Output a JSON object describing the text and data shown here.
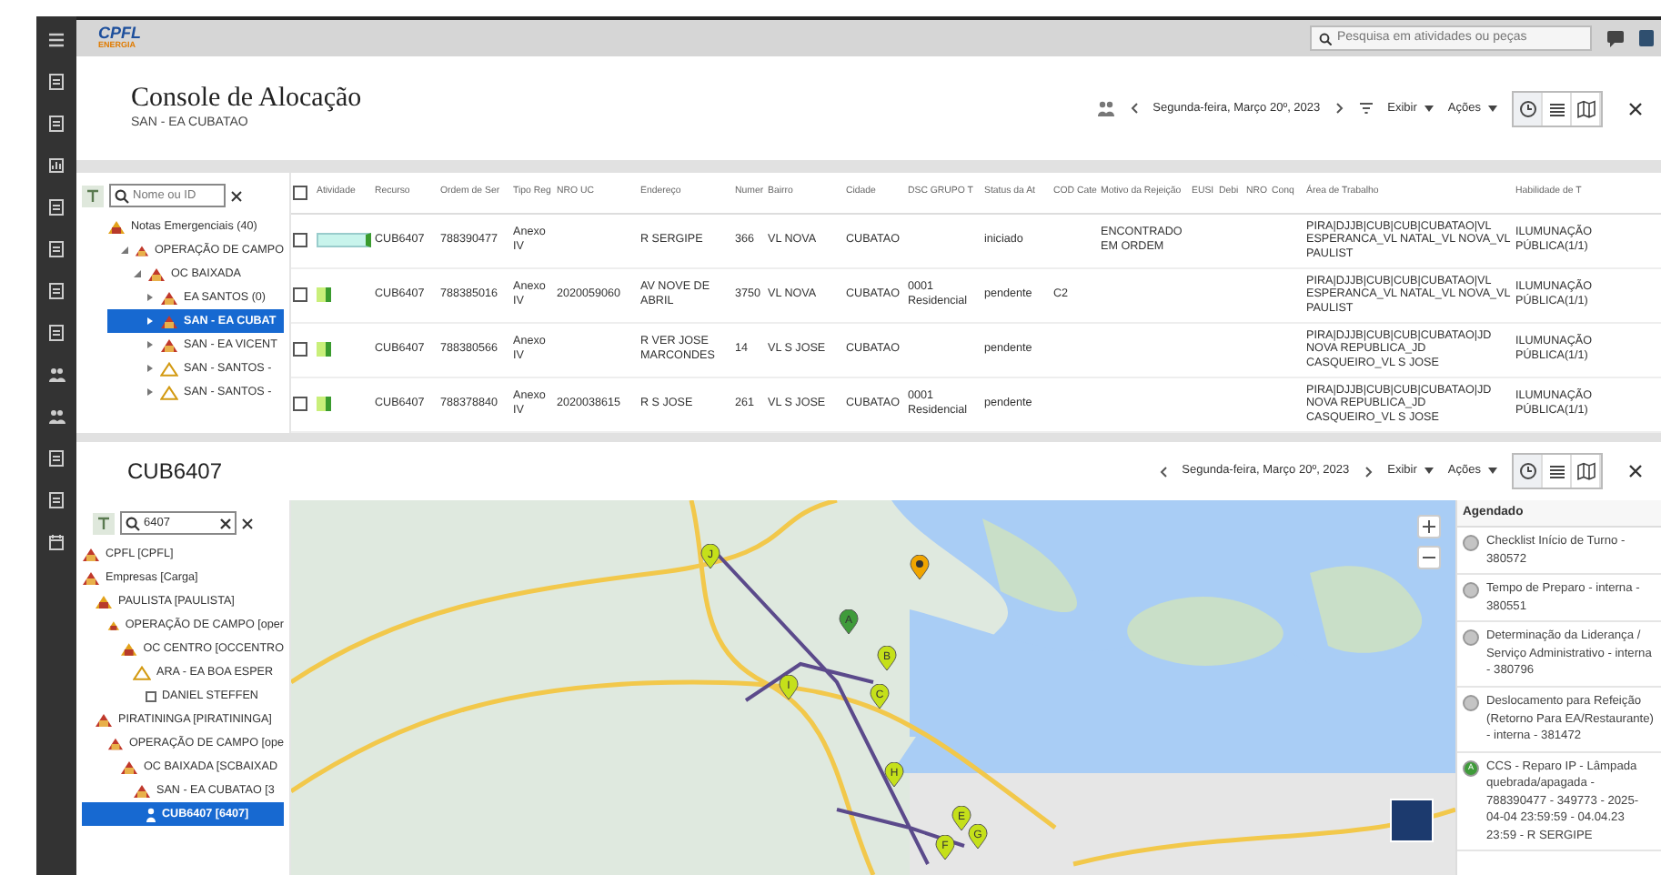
{
  "top_bar": {
    "logo": "CPFL",
    "logo_sub": "ENERGIA",
    "search": {
      "placeholder": "Pesquisa em atividades ou peças"
    }
  },
  "header": {
    "title": "Console de Alocação",
    "subtitle": "SAN - EA CUBATAO",
    "date": "Segunda-feira, Março 20º, 2023",
    "view_menu": "Exibir",
    "actions_menu": "Ações"
  },
  "upper_tree": {
    "search": {
      "placeholder": "Nome ou ID"
    },
    "items": [
      {
        "label": "Notas Emergenciais (40)",
        "kind": "yellow",
        "selected": false,
        "children": [
          {
            "label": "OPERAÇÃO DE CAMPO",
            "kind": "red",
            "expanded": true,
            "selected": false,
            "children": [
              {
                "label": "OC BAIXADA",
                "kind": "red",
                "expanded": true,
                "selected": false,
                "children": [
                  {
                    "label": "EA SANTOS (0)",
                    "kind": "red",
                    "expanded": false,
                    "selected": false
                  },
                  {
                    "label": "SAN - EA CUBAT",
                    "kind": "red",
                    "expanded": false,
                    "selected": true
                  },
                  {
                    "label": "SAN - EA VICENT",
                    "kind": "red",
                    "expanded": false,
                    "selected": false
                  },
                  {
                    "label": "SAN - SANTOS -",
                    "kind": "outline",
                    "expanded": false,
                    "selected": false
                  },
                  {
                    "label": "SAN - SANTOS -",
                    "kind": "outline",
                    "expanded": false,
                    "selected": false
                  }
                ]
              }
            ]
          }
        ]
      }
    ]
  },
  "table": {
    "header_checked": false,
    "activity_column": "Atividade",
    "columns": [
      "Recurso",
      "Ordem de Ser",
      "Tipo Reg",
      "NRO UC",
      "Endereço",
      "Numer",
      "Bairro",
      "Cidade",
      "DSC GRUPO T",
      "Status da At",
      "COD Cate",
      "Motivo da Rejeição",
      "EUSI",
      "Debi",
      "NRO",
      "Conq",
      "Área de Trabalho",
      "Habilidade de T"
    ],
    "rows": [
      {
        "checked": false,
        "kind": "wide",
        "cells": [
          "CUB6407",
          "788390477",
          "Anexo IV",
          null,
          "R SERGIPE",
          "366",
          "VL NOVA",
          "CUBATAO",
          null,
          "iniciado",
          null,
          "ENCONTRADO EM ORDEM",
          null,
          null,
          null,
          null,
          "PIRA|DJJB|CUB|CUB|CUBATAO|VL ESPERANCA_VL NATAL_VL NOVA_VL PAULIST",
          "ILUMUNAÇÃO PÚBLICA(1/1)"
        ]
      },
      {
        "checked": false,
        "kind": "short",
        "cells": [
          "CUB6407",
          "788385016",
          "Anexo IV",
          "2020059060",
          "AV NOVE DE ABRIL",
          "3750",
          "VL NOVA",
          "CUBATAO",
          "0001 Residencial",
          "pendente",
          "C2",
          null,
          null,
          null,
          null,
          null,
          "PIRA|DJJB|CUB|CUB|CUBATAO|VL ESPERANCA_VL NATAL_VL NOVA_VL PAULIST",
          "ILUMUNAÇÃO PÚBLICA(1/1)"
        ]
      },
      {
        "checked": false,
        "kind": "short",
        "cells": [
          "CUB6407",
          "788380566",
          "Anexo IV",
          null,
          "R VER JOSE MARCONDES",
          "14",
          "VL S JOSE",
          "CUBATAO",
          null,
          "pendente",
          null,
          null,
          null,
          null,
          null,
          null,
          "PIRA|DJJB|CUB|CUB|CUBATAO|JD NOVA REPUBLICA_JD CASQUEIRO_VL S JOSE",
          "ILUMUNAÇÃO PÚBLICA(1/1)"
        ]
      },
      {
        "checked": false,
        "kind": "short",
        "cells": [
          "CUB6407",
          "788378840",
          "Anexo IV",
          "2020038615",
          "R S JOSE",
          "261",
          "VL S JOSE",
          "CUBATAO",
          "0001 Residencial",
          "pendente",
          null,
          null,
          null,
          null,
          null,
          null,
          "PIRA|DJJB|CUB|CUB|CUBATAO|JD NOVA REPUBLICA_JD CASQUEIRO_VL S JOSE",
          "ILUMUNAÇÃO PÚBLICA(1/1)"
        ]
      }
    ]
  },
  "resource": {
    "title": "CUB6407",
    "date": "Segunda-feira, Março 20º, 2023",
    "view_menu": "Exibir",
    "actions_menu": "Ações"
  },
  "lower_tree": {
    "search": {
      "value": "6407"
    },
    "items": [
      {
        "label": "CPFL [CPFL]",
        "kind": "red",
        "selected": false
      },
      {
        "label": "Empresas [Carga]",
        "kind": "red",
        "selected": false,
        "children": [
          {
            "label": "PAULISTA [PAULISTA]",
            "kind": "yellow",
            "selected": false,
            "children": [
              {
                "label": "OPERAÇÃO DE CAMPO [oper",
                "kind": "yellow",
                "selected": false,
                "children": [
                  {
                    "label": "OC CENTRO [OCCENTRO",
                    "kind": "yellow",
                    "selected": false,
                    "children": [
                      {
                        "label": "ARA - EA BOA ESPER",
                        "kind": "outline",
                        "selected": false,
                        "children": [
                          {
                            "label": "DANIEL STEFFEN",
                            "kind": "box",
                            "selected": false
                          }
                        ]
                      }
                    ]
                  }
                ]
              }
            ]
          },
          {
            "label": "PIRATININGA [PIRATININGA]",
            "kind": "red",
            "selected": false,
            "children": [
              {
                "label": "OPERAÇÃO DE CAMPO [ope",
                "kind": "red",
                "selected": false,
                "children": [
                  {
                    "label": "OC BAIXADA [SCBAIXAD",
                    "kind": "red",
                    "selected": false,
                    "children": [
                      {
                        "label": "SAN - EA CUBATAO [3",
                        "kind": "red",
                        "selected": false,
                        "children": [
                          {
                            "label": "CUB6407 [6407]",
                            "kind": "person",
                            "selected": true
                          }
                        ]
                      }
                    ]
                  }
                ]
              }
            ]
          }
        ]
      }
    ]
  },
  "map": {
    "pins": [
      {
        "letter": "J",
        "color": "#c5e01a"
      },
      {
        "color": "#f0a500"
      },
      {
        "letter": "A",
        "color": "#3f9b3a"
      },
      {
        "letter": "B",
        "color": "#c5e01a"
      },
      {
        "letter": "I",
        "color": "#c5e01a"
      },
      {
        "letter": "C",
        "color": "#c5e01a"
      },
      {
        "letter": "H",
        "color": "#c5e01a"
      },
      {
        "letter": "E",
        "color": "#c5e01a"
      },
      {
        "letter": "G",
        "color": "#c5e01a"
      },
      {
        "letter": "F",
        "color": "#c5e01a"
      }
    ]
  },
  "agenda": {
    "title": "Agendado",
    "items": [
      {
        "text": "Checklist Início de Turno - 380572",
        "color": "#c4c4c4"
      },
      {
        "text": "Tempo de Preparo - interna - 380551",
        "color": "#c4c4c4"
      },
      {
        "text": "Determinação da Liderança / Serviço Administrativo - interna - 380796",
        "color": "#c4c4c4"
      },
      {
        "text": "Deslocamento para Refeição (Retorno Para EA/Restaurante) - interna - 381472",
        "color": "#c4c4c4"
      },
      {
        "text": "CCS - Reparo IP - Lâmpada quebrada/apagada - 788390477 - 349773 - 2025-04-04 23:59:59 - 04.04.23 23:59 - R SERGIPE",
        "color": "#3f9b3a",
        "letter": "A"
      }
    ]
  }
}
